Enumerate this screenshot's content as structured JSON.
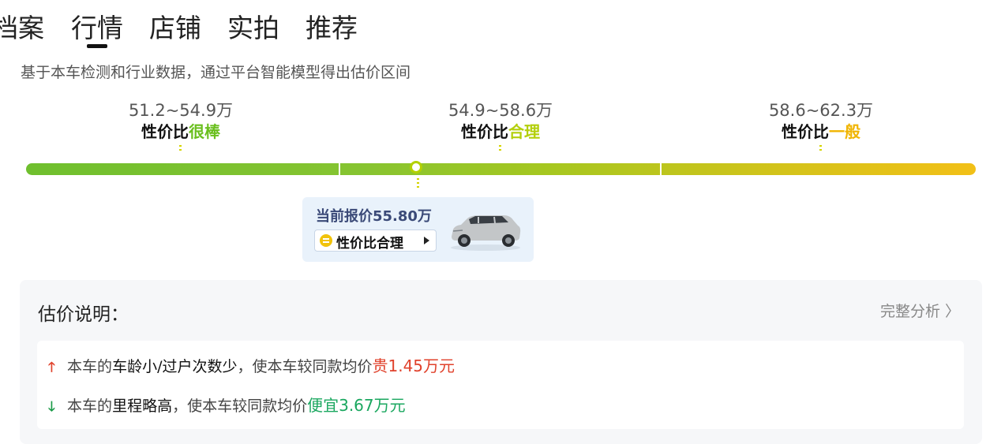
{
  "tabs": [
    {
      "label": "档案"
    },
    {
      "label": "行情",
      "active": true
    },
    {
      "label": "店铺"
    },
    {
      "label": "实拍"
    },
    {
      "label": "推荐"
    }
  ],
  "subtitle": "基于本车检测和行业数据，通过平台智能模型得出估价区间",
  "ranges": [
    {
      "price": "51.2~54.9万",
      "prefix": "性价比",
      "rating": "很棒",
      "color": "#6abf1e"
    },
    {
      "price": "54.9~58.6万",
      "prefix": "性价比",
      "rating": "合理",
      "color": "#b3cf0b"
    },
    {
      "price": "58.6~62.3万",
      "prefix": "性价比",
      "rating": "一般",
      "color": "#f0b400"
    }
  ],
  "current_quote": {
    "text": "当前报价55.80万",
    "badge": "性价比合理",
    "badge_icon": "neutral-face-icon",
    "value_wan": 55.8,
    "scale": {
      "min": 51.2,
      "max": 62.3
    }
  },
  "panel": {
    "title": "估价说明：",
    "full_analysis": "完整分析 〉",
    "reasons": [
      {
        "direction": "up",
        "prefix": "本车的",
        "highlight": "车龄小/过户次数少",
        "middle": "，使本车较同款均价",
        "effect": "贵1.45万元",
        "color": "#e0412b"
      },
      {
        "direction": "down",
        "prefix": "本车的",
        "highlight": "里程略高",
        "middle": "，使本车较同款均价",
        "effect": "便宜3.67万元",
        "color": "#1aa75f"
      }
    ]
  },
  "colors": {
    "accent_green": "#6abf1e",
    "accent_lime": "#b3cf0b",
    "accent_yellow": "#f0b400",
    "card_bg": "#e9f2fb"
  }
}
